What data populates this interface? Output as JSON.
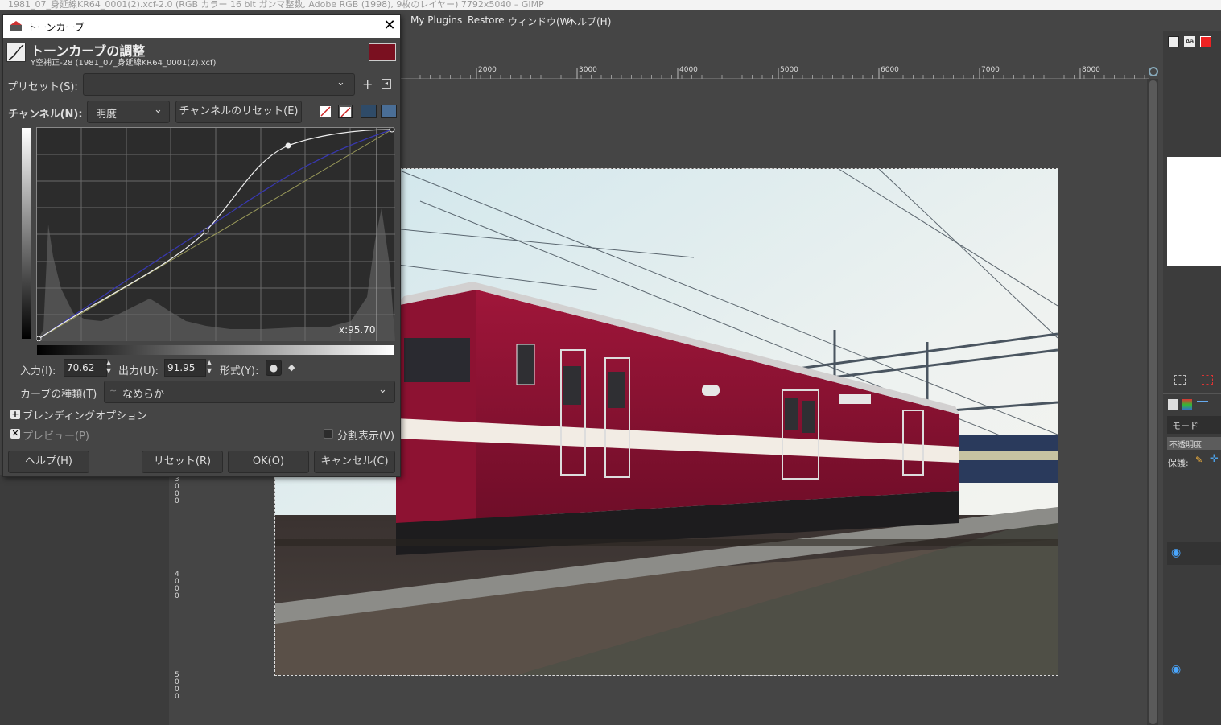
{
  "window": {
    "title": "1981_07_身延線KR64_0001(2).xcf-2.0 (RGB カラー 16 bit ガンマ整数, Adobe RGB (1998), 9枚のレイヤー) 7792x5040 – GIMP"
  },
  "menubar": {
    "items": [
      "My Plugins",
      "Restore",
      "ウィンドウ(W)",
      "ヘルプ(H)"
    ]
  },
  "ruler": {
    "top_labels": [
      "2000",
      "3000",
      "4000",
      "5000",
      "6000",
      "7000",
      "8000"
    ],
    "left_labels": [
      "3000",
      "4000",
      "5000"
    ]
  },
  "dialog": {
    "title": "トーンカーブ",
    "heading": "トーンカーブの調整",
    "subheading": "Y空補正-28 (1981_07_身延線KR64_0001(2).xcf)",
    "preset_label": "プリセット(S):",
    "preset_value": "",
    "channel_label": "チャンネル(N):",
    "channel_value": "明度",
    "channel_reset_button": "チャンネルのリセット(E)",
    "graph_readout": "x:95.70",
    "input_label": "入力(I):",
    "input_value": "70.62",
    "output_label": "出力(U):",
    "output_value": "91.95",
    "format_label": "形式(Y):",
    "curve_type_label": "カーブの種類(T)",
    "curve_type_value": "なめらか",
    "blending_label": "ブレンディングオプション",
    "preview_label": "プレビュー(P)",
    "split_view_label": "分割表示(V)",
    "buttons": {
      "help": "ヘルプ(H)",
      "reset": "リセット(R)",
      "ok": "OK(O)",
      "cancel": "キャンセル(C)"
    }
  },
  "dock": {
    "mode_label": "モード",
    "opacity_label": "不透明度",
    "lock_label": "保護:"
  }
}
